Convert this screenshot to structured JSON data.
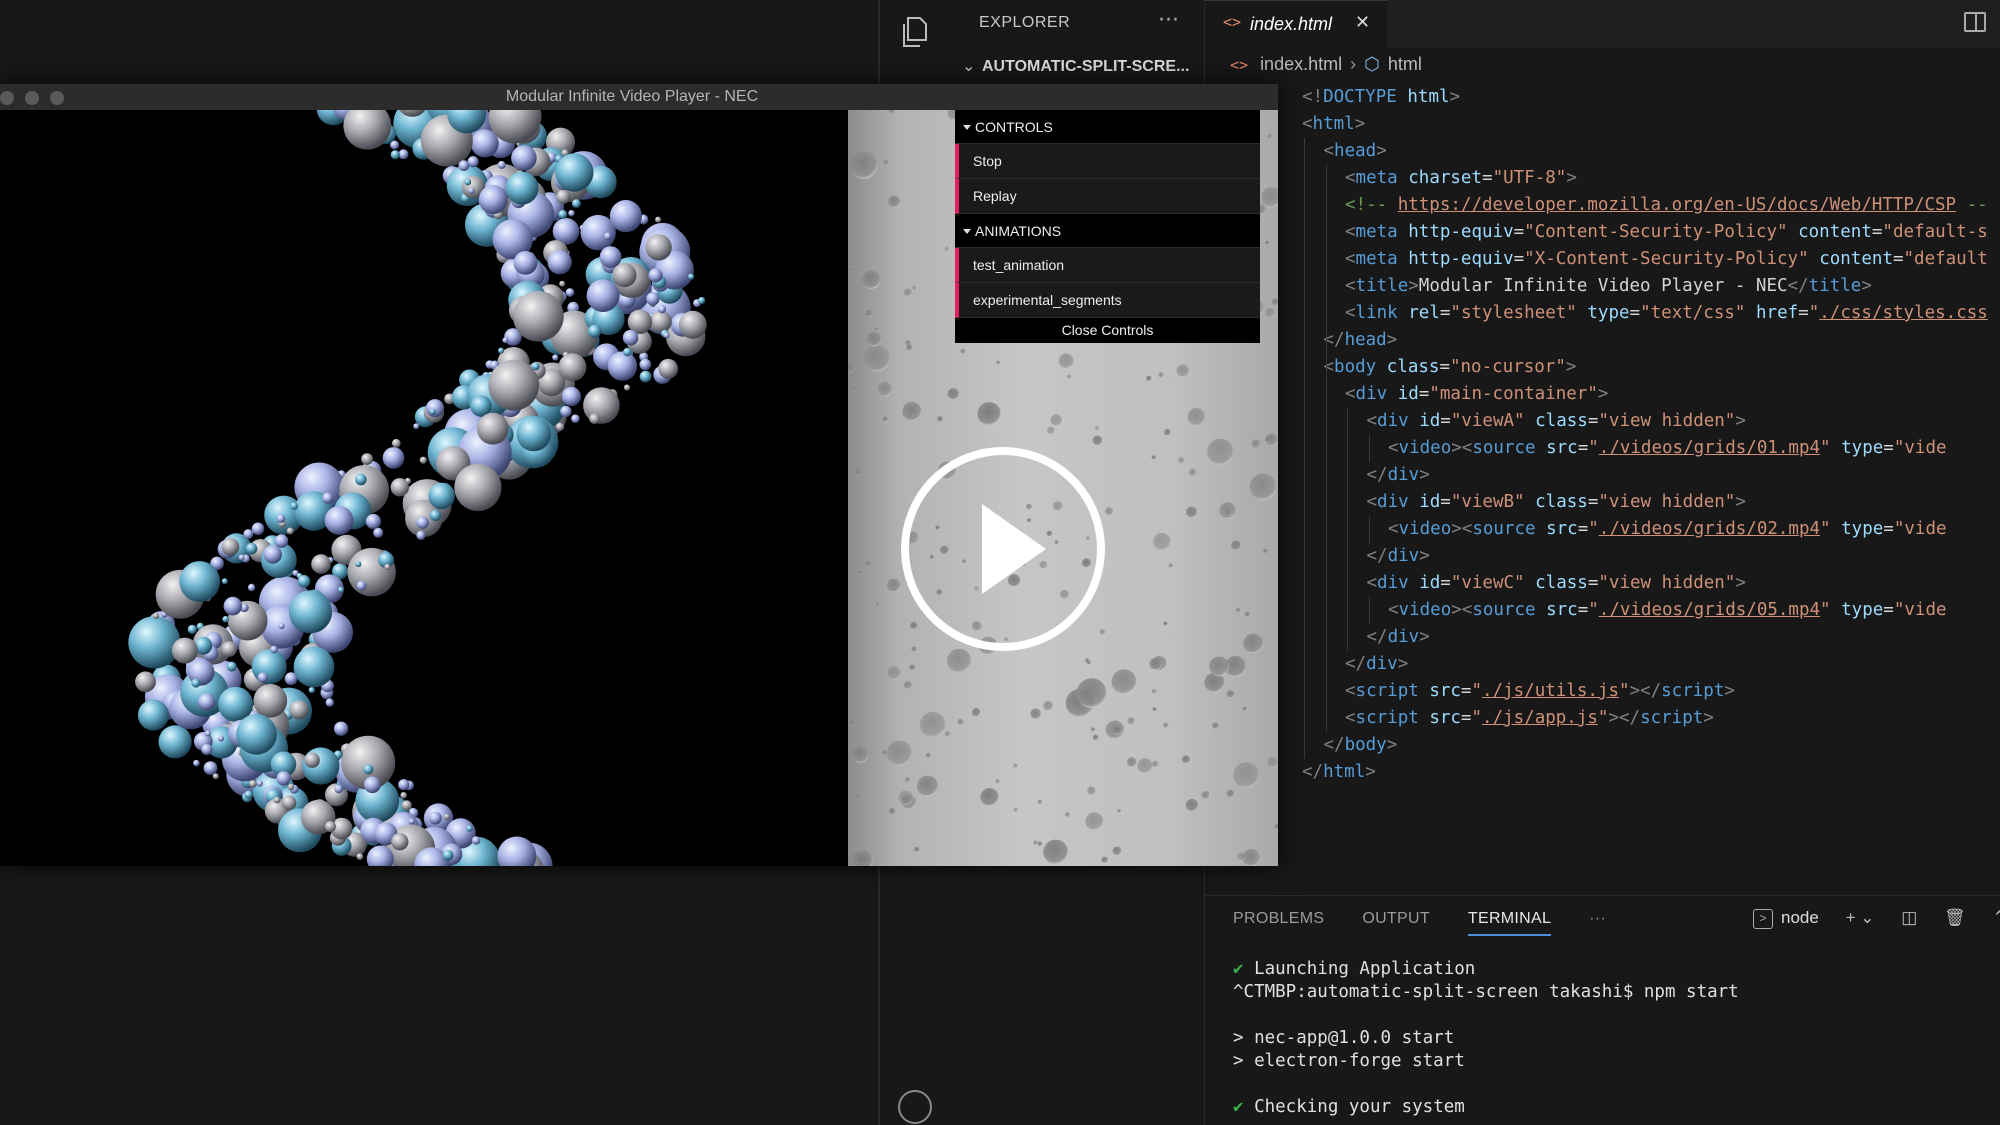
{
  "app_window": {
    "title": "Modular Infinite Video Player - NEC",
    "controls": {
      "folders": [
        {
          "label": "CONTROLS",
          "items": [
            "Stop",
            "Replay"
          ]
        },
        {
          "label": "ANIMATIONS",
          "items": [
            "test_animation",
            "experimental_segments"
          ]
        }
      ],
      "close_label": "Close Controls"
    }
  },
  "explorer": {
    "header": "EXPLORER",
    "more": "···",
    "folder": "AUTOMATIC-SPLIT-SCRE..."
  },
  "editor": {
    "tab": {
      "icon": "<>",
      "name": "index.html",
      "close": "✕"
    },
    "breadcrumb": {
      "file": "index.html",
      "symbol": "html"
    },
    "lines": [
      {
        "indent": 0,
        "tokens": [
          [
            "br",
            "<!"
          ],
          [
            "tag",
            "DOCTYPE"
          ],
          [
            "txt",
            " "
          ],
          [
            "attr",
            "html"
          ],
          [
            "br",
            ">"
          ]
        ]
      },
      {
        "indent": 0,
        "tokens": [
          [
            "br",
            "<"
          ],
          [
            "tag",
            "html"
          ],
          [
            "br",
            ">"
          ]
        ]
      },
      {
        "indent": 1,
        "tokens": [
          [
            "br",
            "<"
          ],
          [
            "tag",
            "head"
          ],
          [
            "br",
            ">"
          ]
        ]
      },
      {
        "indent": 2,
        "tokens": [
          [
            "br",
            "<"
          ],
          [
            "tag",
            "meta"
          ],
          [
            "txt",
            " "
          ],
          [
            "attr",
            "charset"
          ],
          [
            "txt",
            "="
          ],
          [
            "str",
            "\"UTF-8\""
          ],
          [
            "br",
            ">"
          ]
        ]
      },
      {
        "indent": 2,
        "tokens": [
          [
            "cm",
            "<!-- "
          ],
          [
            "link",
            "https://developer.mozilla.org/en-US/docs/Web/HTTP/CSP"
          ],
          [
            "cm",
            " --"
          ]
        ]
      },
      {
        "indent": 2,
        "tokens": [
          [
            "br",
            "<"
          ],
          [
            "tag",
            "meta"
          ],
          [
            "txt",
            " "
          ],
          [
            "attr",
            "http-equiv"
          ],
          [
            "txt",
            "="
          ],
          [
            "str",
            "\"Content-Security-Policy\""
          ],
          [
            "txt",
            " "
          ],
          [
            "attr",
            "content"
          ],
          [
            "txt",
            "="
          ],
          [
            "str",
            "\"default-s"
          ]
        ]
      },
      {
        "indent": 2,
        "tokens": [
          [
            "br",
            "<"
          ],
          [
            "tag",
            "meta"
          ],
          [
            "txt",
            " "
          ],
          [
            "attr",
            "http-equiv"
          ],
          [
            "txt",
            "="
          ],
          [
            "str",
            "\"X-Content-Security-Policy\""
          ],
          [
            "txt",
            " "
          ],
          [
            "attr",
            "content"
          ],
          [
            "txt",
            "="
          ],
          [
            "str",
            "\"default"
          ]
        ]
      },
      {
        "indent": 2,
        "tokens": [
          [
            "br",
            "<"
          ],
          [
            "tag",
            "title"
          ],
          [
            "br",
            ">"
          ],
          [
            "txt",
            "Modular Infinite Video Player - NEC"
          ],
          [
            "br",
            "</"
          ],
          [
            "tag",
            "title"
          ],
          [
            "br",
            ">"
          ]
        ]
      },
      {
        "indent": 2,
        "tokens": [
          [
            "br",
            "<"
          ],
          [
            "tag",
            "link"
          ],
          [
            "txt",
            " "
          ],
          [
            "attr",
            "rel"
          ],
          [
            "txt",
            "="
          ],
          [
            "str",
            "\"stylesheet\""
          ],
          [
            "txt",
            " "
          ],
          [
            "attr",
            "type"
          ],
          [
            "txt",
            "="
          ],
          [
            "str",
            "\"text/css\""
          ],
          [
            "txt",
            " "
          ],
          [
            "attr",
            "href"
          ],
          [
            "txt",
            "="
          ],
          [
            "str",
            "\""
          ],
          [
            "link",
            "./css/styles.css"
          ]
        ]
      },
      {
        "indent": 1,
        "tokens": [
          [
            "br",
            "</"
          ],
          [
            "tag",
            "head"
          ],
          [
            "br",
            ">"
          ]
        ]
      },
      {
        "indent": 1,
        "tokens": [
          [
            "br",
            "<"
          ],
          [
            "tag",
            "body"
          ],
          [
            "txt",
            " "
          ],
          [
            "attr",
            "class"
          ],
          [
            "txt",
            "="
          ],
          [
            "str",
            "\"no-cursor\""
          ],
          [
            "br",
            ">"
          ]
        ]
      },
      {
        "indent": 2,
        "tokens": [
          [
            "br",
            "<"
          ],
          [
            "tag",
            "div"
          ],
          [
            "txt",
            " "
          ],
          [
            "attr",
            "id"
          ],
          [
            "txt",
            "="
          ],
          [
            "str",
            "\"main-container\""
          ],
          [
            "br",
            ">"
          ]
        ]
      },
      {
        "indent": 3,
        "tokens": [
          [
            "br",
            "<"
          ],
          [
            "tag",
            "div"
          ],
          [
            "txt",
            " "
          ],
          [
            "attr",
            "id"
          ],
          [
            "txt",
            "="
          ],
          [
            "str",
            "\"viewA\""
          ],
          [
            "txt",
            " "
          ],
          [
            "attr",
            "class"
          ],
          [
            "txt",
            "="
          ],
          [
            "str",
            "\"view hidden\""
          ],
          [
            "br",
            ">"
          ]
        ]
      },
      {
        "indent": 4,
        "tokens": [
          [
            "br",
            "<"
          ],
          [
            "tag",
            "video"
          ],
          [
            "br",
            "><"
          ],
          [
            "tag",
            "source"
          ],
          [
            "txt",
            " "
          ],
          [
            "attr",
            "src"
          ],
          [
            "txt",
            "="
          ],
          [
            "str",
            "\""
          ],
          [
            "link",
            "./videos/grids/01.mp4"
          ],
          [
            "str",
            "\""
          ],
          [
            "txt",
            " "
          ],
          [
            "attr",
            "type"
          ],
          [
            "txt",
            "="
          ],
          [
            "str",
            "\"vide"
          ]
        ]
      },
      {
        "indent": 3,
        "tokens": [
          [
            "br",
            "</"
          ],
          [
            "tag",
            "div"
          ],
          [
            "br",
            ">"
          ]
        ]
      },
      {
        "indent": 3,
        "tokens": [
          [
            "br",
            "<"
          ],
          [
            "tag",
            "div"
          ],
          [
            "txt",
            " "
          ],
          [
            "attr",
            "id"
          ],
          [
            "txt",
            "="
          ],
          [
            "str",
            "\"viewB\""
          ],
          [
            "txt",
            " "
          ],
          [
            "attr",
            "class"
          ],
          [
            "txt",
            "="
          ],
          [
            "str",
            "\"view hidden\""
          ],
          [
            "br",
            ">"
          ]
        ]
      },
      {
        "indent": 4,
        "tokens": [
          [
            "br",
            "<"
          ],
          [
            "tag",
            "video"
          ],
          [
            "br",
            "><"
          ],
          [
            "tag",
            "source"
          ],
          [
            "txt",
            " "
          ],
          [
            "attr",
            "src"
          ],
          [
            "txt",
            "="
          ],
          [
            "str",
            "\""
          ],
          [
            "link",
            "./videos/grids/02.mp4"
          ],
          [
            "str",
            "\""
          ],
          [
            "txt",
            " "
          ],
          [
            "attr",
            "type"
          ],
          [
            "txt",
            "="
          ],
          [
            "str",
            "\"vide"
          ]
        ]
      },
      {
        "indent": 3,
        "tokens": [
          [
            "br",
            "</"
          ],
          [
            "tag",
            "div"
          ],
          [
            "br",
            ">"
          ]
        ]
      },
      {
        "indent": 3,
        "tokens": [
          [
            "br",
            "<"
          ],
          [
            "tag",
            "div"
          ],
          [
            "txt",
            " "
          ],
          [
            "attr",
            "id"
          ],
          [
            "txt",
            "="
          ],
          [
            "str",
            "\"viewC\""
          ],
          [
            "txt",
            " "
          ],
          [
            "attr",
            "class"
          ],
          [
            "txt",
            "="
          ],
          [
            "str",
            "\"view hidden\""
          ],
          [
            "br",
            ">"
          ]
        ]
      },
      {
        "indent": 4,
        "tokens": [
          [
            "br",
            "<"
          ],
          [
            "tag",
            "video"
          ],
          [
            "br",
            "><"
          ],
          [
            "tag",
            "source"
          ],
          [
            "txt",
            " "
          ],
          [
            "attr",
            "src"
          ],
          [
            "txt",
            "="
          ],
          [
            "str",
            "\""
          ],
          [
            "link",
            "./videos/grids/05.mp4"
          ],
          [
            "str",
            "\""
          ],
          [
            "txt",
            " "
          ],
          [
            "attr",
            "type"
          ],
          [
            "txt",
            "="
          ],
          [
            "str",
            "\"vide"
          ]
        ]
      },
      {
        "indent": 3,
        "tokens": [
          [
            "br",
            "</"
          ],
          [
            "tag",
            "div"
          ],
          [
            "br",
            ">"
          ]
        ]
      },
      {
        "indent": 2,
        "tokens": [
          [
            "br",
            "</"
          ],
          [
            "tag",
            "div"
          ],
          [
            "br",
            ">"
          ]
        ]
      },
      {
        "indent": 2,
        "tokens": [
          [
            "br",
            "<"
          ],
          [
            "tag",
            "script"
          ],
          [
            "txt",
            " "
          ],
          [
            "attr",
            "src"
          ],
          [
            "txt",
            "="
          ],
          [
            "str",
            "\""
          ],
          [
            "link",
            "./js/utils.js"
          ],
          [
            "str",
            "\""
          ],
          [
            "br",
            "></"
          ],
          [
            "tag",
            "script"
          ],
          [
            "br",
            ">"
          ]
        ]
      },
      {
        "indent": 2,
        "tokens": [
          [
            "br",
            "<"
          ],
          [
            "tag",
            "script"
          ],
          [
            "txt",
            " "
          ],
          [
            "attr",
            "src"
          ],
          [
            "txt",
            "="
          ],
          [
            "str",
            "\""
          ],
          [
            "link",
            "./js/app.js"
          ],
          [
            "str",
            "\""
          ],
          [
            "br",
            "></"
          ],
          [
            "tag",
            "script"
          ],
          [
            "br",
            ">"
          ]
        ]
      },
      {
        "indent": 1,
        "tokens": [
          [
            "br",
            "</"
          ],
          [
            "tag",
            "body"
          ],
          [
            "br",
            ">"
          ]
        ]
      },
      {
        "indent": 0,
        "tokens": [
          [
            "br",
            "</"
          ],
          [
            "tag",
            "html"
          ],
          [
            "br",
            ">"
          ]
        ]
      }
    ]
  },
  "panel": {
    "tabs": [
      "PROBLEMS",
      "OUTPUT",
      "TERMINAL",
      "···"
    ],
    "active_tab": "TERMINAL",
    "terminal_name": "node",
    "terminal_lines": [
      {
        "check": true,
        "text": "Launching Application"
      },
      {
        "check": false,
        "text": "^CTMBP:automatic-split-screen takashi$ npm start"
      },
      {
        "check": false,
        "text": ""
      },
      {
        "check": false,
        "text": "> nec-app@1.0.0 start"
      },
      {
        "check": false,
        "text": "> electron-forge start"
      },
      {
        "check": false,
        "text": ""
      },
      {
        "check": true,
        "text": "Checking your system"
      }
    ]
  },
  "colors": {
    "accent_pink": "#e61d5f",
    "tab_blue": "#4a8fd8",
    "check_green": "#37b24d"
  }
}
